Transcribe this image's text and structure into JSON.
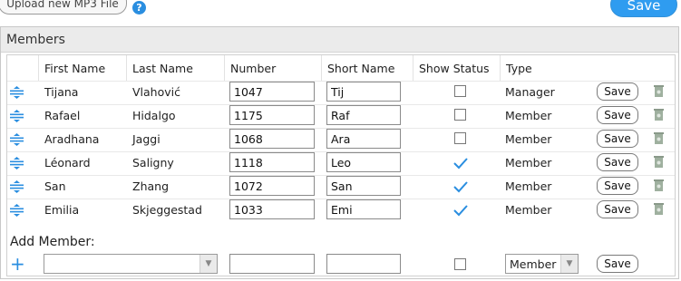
{
  "toolbar": {
    "upload_label": "Upload new MP3 File",
    "help_icon": "help-icon",
    "save_label": "Save"
  },
  "panel": {
    "title": "Members"
  },
  "table": {
    "columns": [
      "First Name",
      "Last Name",
      "Number",
      "Short Name",
      "Show Status",
      "Type"
    ],
    "rows": [
      {
        "first": "Tijana",
        "last": "Vlahović",
        "number": "1047",
        "short": "Tij",
        "show_status": false,
        "type": "Manager",
        "save": "Save"
      },
      {
        "first": "Rafael",
        "last": "Hidalgo",
        "number": "1175",
        "short": "Raf",
        "show_status": false,
        "type": "Member",
        "save": "Save"
      },
      {
        "first": "Aradhana",
        "last": "Jaggi",
        "number": "1068",
        "short": "Ara",
        "show_status": false,
        "type": "Member",
        "save": "Save"
      },
      {
        "first": "Léonard",
        "last": "Saligny",
        "number": "1118",
        "short": "Leo",
        "show_status": true,
        "type": "Member",
        "save": "Save"
      },
      {
        "first": "San",
        "last": "Zhang",
        "number": "1072",
        "short": "San",
        "show_status": true,
        "type": "Member",
        "save": "Save"
      },
      {
        "first": "Emilia",
        "last": "Skjeggestad",
        "number": "1033",
        "short": "Emi",
        "show_status": true,
        "type": "Member",
        "save": "Save"
      }
    ]
  },
  "add_member": {
    "label": "Add Member:",
    "name_value": "",
    "number_value": "",
    "short_value": "",
    "show_status": false,
    "type_value": "Member",
    "save_label": "Save"
  },
  "colors": {
    "accent": "#2a8ee0",
    "check": "#2a8ee0",
    "header_bg": "#ebebeb"
  }
}
